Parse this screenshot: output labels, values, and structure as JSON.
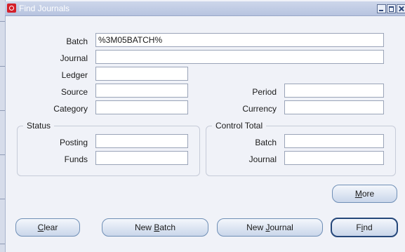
{
  "window": {
    "title": "Find Journals"
  },
  "fields": {
    "batch": {
      "label": "Batch",
      "value": "%3M05BATCH%"
    },
    "journal": {
      "label": "Journal",
      "value": ""
    },
    "ledger": {
      "label": "Ledger",
      "value": ""
    },
    "source": {
      "label": "Source",
      "value": ""
    },
    "period": {
      "label": "Period",
      "value": ""
    },
    "category": {
      "label": "Category",
      "value": ""
    },
    "currency": {
      "label": "Currency",
      "value": ""
    }
  },
  "status_group": {
    "title": "Status",
    "posting": {
      "label": "Posting",
      "value": ""
    },
    "funds": {
      "label": "Funds",
      "value": ""
    }
  },
  "control_total_group": {
    "title": "Control Total",
    "batch": {
      "label": "Batch",
      "value": ""
    },
    "journal": {
      "label": "Journal",
      "value": ""
    }
  },
  "buttons": {
    "more": {
      "pre": "",
      "key": "M",
      "post": "ore"
    },
    "clear": {
      "pre": "",
      "key": "C",
      "post": "lear"
    },
    "new_batch": {
      "pre": "New ",
      "key": "B",
      "post": "atch"
    },
    "new_journal": {
      "pre": "New ",
      "key": "J",
      "post": "ournal"
    },
    "find": {
      "pre": "F",
      "key": "i",
      "post": "nd"
    }
  }
}
